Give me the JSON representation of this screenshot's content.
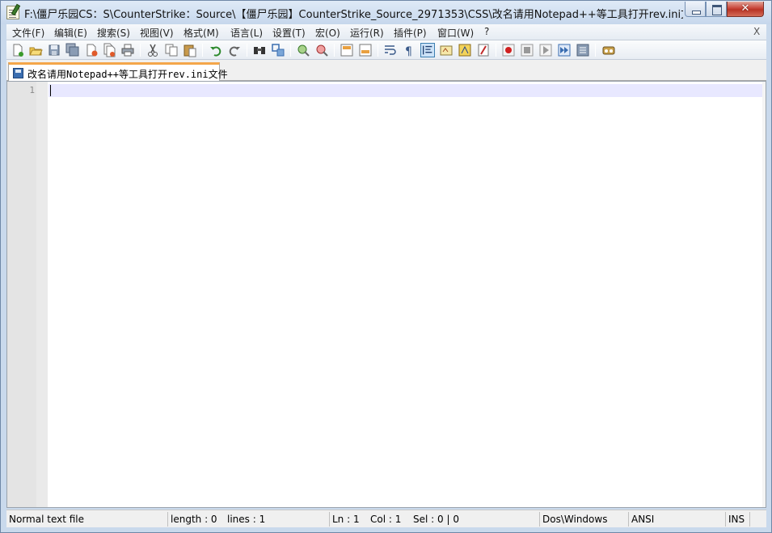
{
  "window": {
    "title": "F:\\僵尸乐园CS：S\\CounterStrike：Source\\【僵尸乐园】CounterStrike_Source_2971353\\CSS\\改名请用Notepad++等工具打开rev.ini文件 - Note...",
    "close_glyph": "✕"
  },
  "menubar": {
    "items": [
      "文件(F)",
      "编辑(E)",
      "搜索(S)",
      "视图(V)",
      "格式(M)",
      "语言(L)",
      "设置(T)",
      "宏(O)",
      "运行(R)",
      "插件(P)",
      "窗口(W)",
      "?"
    ],
    "close_label": "X"
  },
  "toolbar": {
    "icons": [
      "new-file-icon",
      "open-file-icon",
      "save-icon",
      "save-all-icon",
      "close-icon",
      "close-all-icon",
      "print-icon",
      "cut-icon",
      "copy-icon",
      "paste-icon",
      "undo-icon",
      "redo-icon",
      "find-icon",
      "replace-icon",
      "zoom-in-icon",
      "zoom-out-icon",
      "sync-vertical-icon",
      "sync-horizontal-icon",
      "word-wrap-icon",
      "show-all-characters-icon",
      "indent-guide-icon",
      "user-language-icon",
      "document-map-icon",
      "function-list-icon",
      "macro-record-icon",
      "macro-stop-icon",
      "macro-play-icon",
      "macro-run-multiple-icon",
      "macro-save-icon",
      "plugin-icon"
    ]
  },
  "tabs": [
    {
      "label": "改名请用Notepad++等工具打开rev.ini文件"
    }
  ],
  "editor": {
    "line_numbers": [
      "1"
    ],
    "content": ""
  },
  "status": {
    "file_type": "Normal text file",
    "length": "length : 0",
    "lines": "lines : 1",
    "ln": "Ln : 1",
    "col": "Col : 1",
    "sel": "Sel : 0 | 0",
    "eol": "Dos\\Windows",
    "encoding": "ANSI",
    "mode": "INS"
  },
  "colors": {
    "tab_accent": "#f4a64a",
    "current_line": "#e8e8ff",
    "gutter": "#e4e4e4",
    "title_gradient_top": "#dfeaf7"
  }
}
